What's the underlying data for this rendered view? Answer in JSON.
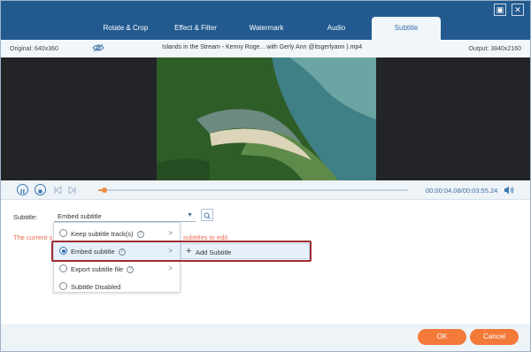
{
  "tabs": [
    {
      "label": "Rotate & Crop"
    },
    {
      "label": "Effect & Filter"
    },
    {
      "label": "Watermark"
    },
    {
      "label": "Audio"
    },
    {
      "label": "Subtitle"
    }
  ],
  "window_controls": {
    "restore": "▣",
    "close": "✕"
  },
  "info": {
    "original": "Original: 640x360",
    "filename": "Islands in the Stream - Kenny Roge... with Gerly Ann @itsgerlyann ).mp4",
    "output": "Output: 3840x2160"
  },
  "player": {
    "time": "00:00:04.08/00:03:55.24",
    "progress_fraction": 0.02
  },
  "subtitle": {
    "label": "Subtitle:",
    "selected": "Embed subtitle",
    "warning_left": "The current s",
    "warning_right": "subtitles to edit."
  },
  "dropdown": {
    "items": [
      {
        "label": "Keep subtitle track(s)",
        "help": "?",
        "chevron": ">"
      },
      {
        "label": "Embed subtitle",
        "help": "?",
        "chevron": ">"
      },
      {
        "label": "Export subtitle file",
        "help": "?",
        "chevron": ">"
      },
      {
        "label": "Subtitle Disabled"
      }
    ],
    "submenu": {
      "plus": "+",
      "label": "Add Subtitle"
    }
  },
  "footer": {
    "ok": "OK",
    "cancel": "Cancel"
  },
  "colors": {
    "accent": "#f47a3a",
    "header": "#225a8f",
    "highlight": "#9e2c33"
  }
}
